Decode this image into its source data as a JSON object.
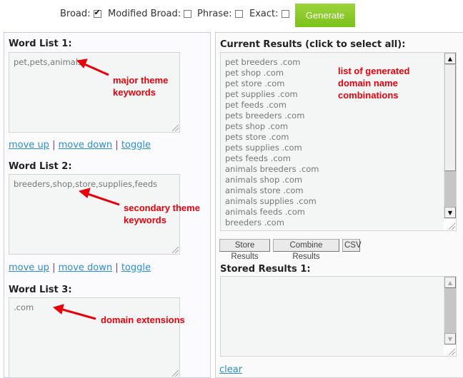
{
  "options": {
    "broad": {
      "label": "Broad:",
      "checked": true
    },
    "modified_broad": {
      "label": "Modified Broad:",
      "checked": false
    },
    "phrase": {
      "label": "Phrase:",
      "checked": false
    },
    "exact": {
      "label": "Exact:",
      "checked": false
    },
    "generate_label": "Generate"
  },
  "word_lists": [
    {
      "label": "Word List 1:",
      "value": "pet,pets,animals,",
      "annotation": [
        "major theme",
        "keywords"
      ]
    },
    {
      "label": "Word List 2:",
      "value": "breeders,shop,store,supplies,feeds",
      "annotation": [
        "secondary theme",
        "keywords"
      ]
    },
    {
      "label": "Word List 3:",
      "value": ".com",
      "annotation": [
        "domain extensions"
      ]
    }
  ],
  "list_links": {
    "move_up": "move up",
    "move_down": "move down",
    "toggle": "toggle",
    "separator": "|"
  },
  "current_results": {
    "label": "Current Results (click to select all):",
    "items": [
      "pet breeders .com",
      "pet shop .com",
      "pet store .com",
      "pet supplies .com",
      "pet feeds .com",
      "pets breeders .com",
      "pets shop .com",
      "pets store .com",
      "pets supplies .com",
      "pets feeds .com",
      "animals breeders .com",
      "animals shop .com",
      "animals store .com",
      "animals supplies .com",
      "animals feeds .com",
      "breeders .com"
    ],
    "annotation": [
      "list of generated",
      "domain name",
      "combinations"
    ]
  },
  "buttons": {
    "store": "Store Results",
    "combine": "Combine Results",
    "csv": "CSV"
  },
  "stored_results": {
    "label": "Stored Results 1:",
    "value": "",
    "clear_label": "clear"
  },
  "colors": {
    "generate_bg": "#8cc926",
    "annotation": "#e8000a",
    "link": "#2a8fd0"
  }
}
